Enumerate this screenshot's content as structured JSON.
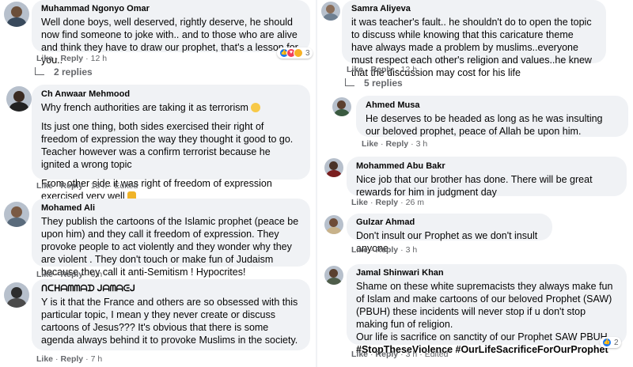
{
  "left": [
    {
      "name": "Muhammad Ngonyo Omar",
      "lines": [
        "Well done boys, well deserved, rightly deserve, he should now find someone to joke with.. and to those who are alive and think they have to draw our prophet, that's a lesson for you.."
      ],
      "like": "Like",
      "reply": "Reply",
      "time": "12 h",
      "reaction_count": "3",
      "replies": "2 replies"
    },
    {
      "name": "Ch Anwaar Mehmood",
      "lines": [
        "Why french authorities are taking it as terrorism",
        "Its just one thing, both sides exercised their right of freedom of expression the way they thought it good to go. Teacher however was a confirm terrorist because he ignited a wrong topic",
        "From other side it was right of freedom of expression exercised very well"
      ],
      "like": "Like",
      "reply": "Reply",
      "time": "13 h",
      "edited": "Edited"
    },
    {
      "name": "Mohamed Ali",
      "lines": [
        "They publish the cartoons of the Islamic prophet (peace be upon him) and they call it freedom of expression. They provoke people to act violently and they wonder why they are violent . They don't touch or make fun of Judaism because they call it anti-Semitism ! Hypocrites!"
      ],
      "like": "Like",
      "reply": "Reply",
      "time": "9 h"
    },
    {
      "name": "ᑎᑕᕼᗩᗰᗰᗩᗪ ᒍᗩᗰᗩᕮᒍ",
      "lines": [
        "Y is it that the France and others are so obsessed with this particular topic, I mean y they never create or discuss cartoons of Jesus??? It's obvious that there is some agenda always behind it to provoke Muslims in the society."
      ],
      "like": "Like",
      "reply": "Reply",
      "time": "7 h"
    }
  ],
  "right": [
    {
      "name": "Samra Aliyeva",
      "lines": [
        "it was teacher's fault.. he shouldn't do to open the topic to discuss while knowing that this caricature theme have always made a problem by muslims..everyone must respect each other's religion and values..he knew that the discussion may cost for his life"
      ],
      "like": "Like",
      "reply": "Reply",
      "time": "12 h",
      "replies": "5 replies"
    },
    {
      "name": "Ahmed Musa",
      "lines": [
        "He deserves to be headed as long as he was insulting our beloved prophet, peace of Allah be upon him."
      ],
      "like": "Like",
      "reply": "Reply",
      "time": "3 h"
    },
    {
      "name": "Mohammed Abu Bakr",
      "lines": [
        "Nice job that our brother has done. There will be great rewards for him in judgment day"
      ],
      "like": "Like",
      "reply": "Reply",
      "time": "26 m"
    },
    {
      "name": "Gulzar Ahmad",
      "lines": [
        "Don't insult our Prophet as we don't insult anyone"
      ],
      "like": "Like",
      "reply": "Reply",
      "time": "3 h"
    },
    {
      "name": "Jamal Shinwari Khan",
      "lines": [
        "Shame on these white supremacists they always make fun of Islam and make cartoons of our beloved Prophet (SAW) (PBUH) these incidents will never stop if u don't stop making fun of religion.",
        "Our life is sacrifice on sanctity of our Prophet SAW PBUH."
      ],
      "hashtags": "#StopTheseViolence #OurLifeSacrificeForOurProphet",
      "like": "Like",
      "reply": "Reply",
      "time": "3 h",
      "edited": "Edited",
      "reaction_count": "2"
    }
  ],
  "colors": {
    "bubble": "#f0f2f5",
    "meta": "#65676b",
    "like_blue": "#1877f2",
    "love_red": "#f33e58"
  }
}
